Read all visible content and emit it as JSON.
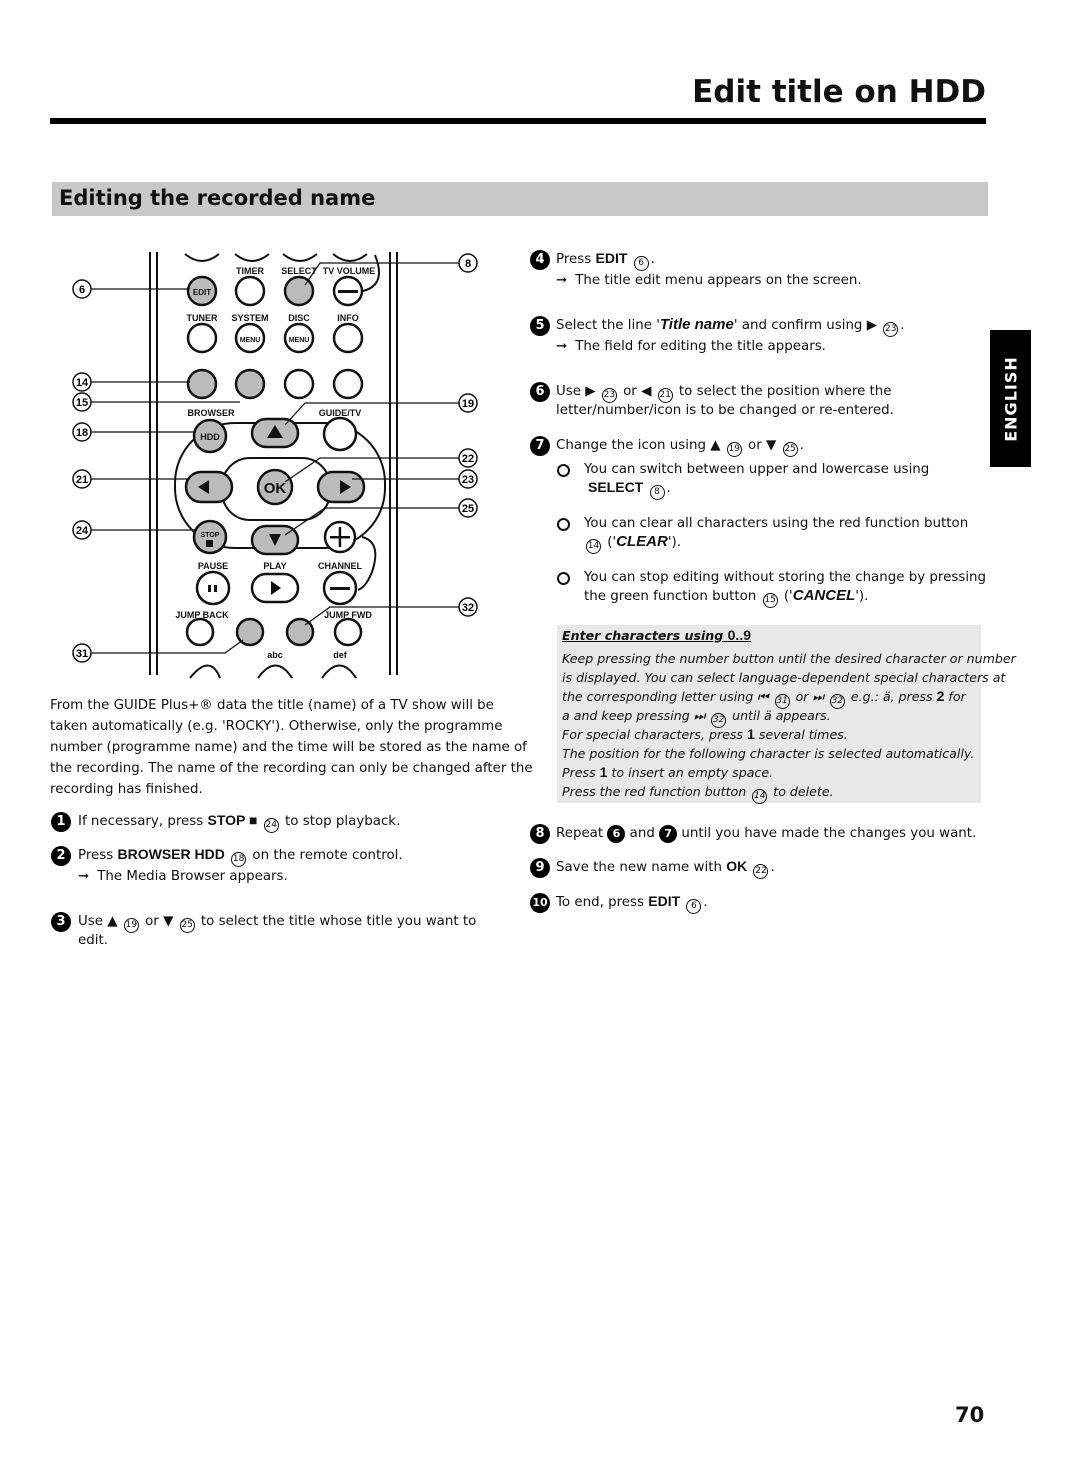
{
  "header": {
    "title": "Edit title on HDD"
  },
  "section": {
    "heading": "Editing the recorded name"
  },
  "side_tab": "ENGLISH",
  "page_number": "70",
  "remote": {
    "labels": {
      "timer": "TIMER",
      "select": "SELECT",
      "tv_volume": "TV VOLUME",
      "tuner": "TUNER",
      "system": "SYSTEM",
      "disc": "DISC",
      "info": "INFO",
      "browser": "BROWSER",
      "guide_tv": "GUIDE/TV",
      "pause": "PAUSE",
      "play": "PLAY",
      "channel": "CHANNEL",
      "jump_back": "JUMP BACK",
      "jump_fwd": "JUMP FWD",
      "abc": "abc",
      "def": "def"
    },
    "buttons": {
      "edit": "EDIT",
      "menu": "MENU",
      "hdd": "HDD",
      "ok": "OK",
      "stop": "STOP"
    },
    "callouts": {
      "c6": "6",
      "c8": "8",
      "c14": "14",
      "c15": "15",
      "c18": "18",
      "c19": "19",
      "c21": "21",
      "c22": "22",
      "c23": "23",
      "c24": "24",
      "c25": "25",
      "c31": "31",
      "c32": "32"
    }
  },
  "intro": [
    "From the GUIDE Plus+® data the title (name) of a TV show will be",
    "taken automatically (e.g. 'ROCKY'). Otherwise, only the programme",
    "number (programme name) and the time will be stored as the name of",
    "the recording. The name of the recording can only be changed after the",
    "recording has finished."
  ],
  "steps": {
    "s1": {
      "num": "1",
      "a": "If necessary, press",
      "key": "STOP ■",
      "ref": "24",
      "b": "to stop playback."
    },
    "s2": {
      "num": "2",
      "a": "Press",
      "key": "BROWSER HDD",
      "ref": "18",
      "b": "on the remote control.",
      "result": "The Media Browser appears."
    },
    "s3": {
      "num": "3",
      "a": "Use ▲",
      "ref1": "19",
      "or": "or ▼",
      "ref2": "25",
      "b": "to select the title whose title you want to",
      "b2": "edit."
    },
    "s4": {
      "num": "4",
      "a": "Press",
      "key": "EDIT",
      "ref": "6",
      "result": "The title edit menu appears on the screen."
    },
    "s5": {
      "num": "5",
      "a": "Select the line '",
      "key": "Title name",
      "b": "' and confirm using ▶",
      "ref": "23",
      "result": "The field for editing the title appears."
    },
    "s6": {
      "num": "6",
      "a": "Use ▶",
      "ref1": "23",
      "or": "or ◀",
      "ref2": "21",
      "b": "to select the position where the",
      "b2": "letter/number/icon is to be changed or re-entered."
    },
    "s7": {
      "num": "7",
      "a": "Change the icon using ▲",
      "ref1": "19",
      "or": "or ▼",
      "ref2": "25",
      "bullets": [
        {
          "a": "You can switch between upper and lowercase using",
          "key": "SELECT",
          "ref": "8"
        },
        {
          "a": "You can clear all characters using the red function button",
          "ref": "14",
          "key": "CLEAR"
        },
        {
          "a": "You can stop editing without storing the change by pressing",
          "a2": "the green function button",
          "ref": "15",
          "key": "CANCEL"
        }
      ]
    },
    "s8": {
      "num": "8",
      "a": "Repeat",
      "r1": "6",
      "and": "and",
      "r2": "7",
      "b": "until you have made the changes you want."
    },
    "s9": {
      "num": "9",
      "a": "Save the new name with",
      "key": "OK",
      "ref": "22"
    },
    "s10": {
      "num": "10",
      "a": "To end, press",
      "key": "EDIT",
      "ref": "6"
    }
  },
  "note": {
    "heading": "Enter characters using",
    "heading_key": "0..9",
    "l1": "Keep pressing the number button until the desired character or number",
    "l2": "is displayed. You can select language-dependent special characters at",
    "l3a": "the corresponding letter using ⏮",
    "l3r1": "31",
    "l3b": "or ⏭",
    "l3r2": "32",
    "l3c": "e.g.: ä, press",
    "l3k": "2",
    "l3d": "for",
    "l4a": "a and keep pressing ⏭",
    "l4r": "32",
    "l4b": "until ä appears.",
    "l5a": "For special characters, press",
    "l5k": "1",
    "l5b": "several times.",
    "l6": "The position for the following character is selected automatically.",
    "l7a": "Press",
    "l7k": "1",
    "l7b": "to insert an empty space.",
    "l8a": "Press the red function button",
    "l8r": "14",
    "l8b": "to delete."
  }
}
